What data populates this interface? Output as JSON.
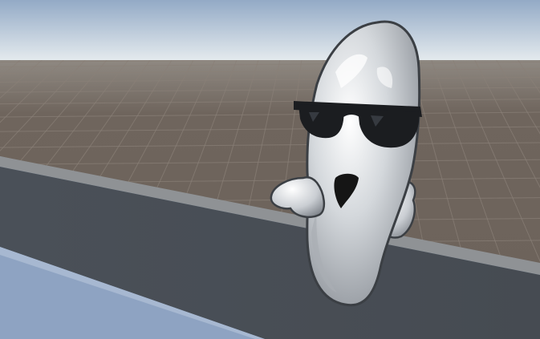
{
  "scene": {
    "sky": {
      "top_color": "#93aac6",
      "horizon_color": "#e9eef0"
    },
    "ground": {
      "color": "#6f655d",
      "grid_color": "#8a8078"
    },
    "wall": {
      "top_edge_color": "#8f9295",
      "face_color": "#464b52"
    },
    "foreground_slab": {
      "color": "#8ea3c2"
    },
    "character": {
      "description_icon": "ghost-character-icon",
      "body_color": "#d4d8dc",
      "shade_color": "#8b9097",
      "outline_color": "#3b3f44",
      "sunglasses_color": "#1b1d20",
      "mouth_color": "#151515"
    }
  }
}
